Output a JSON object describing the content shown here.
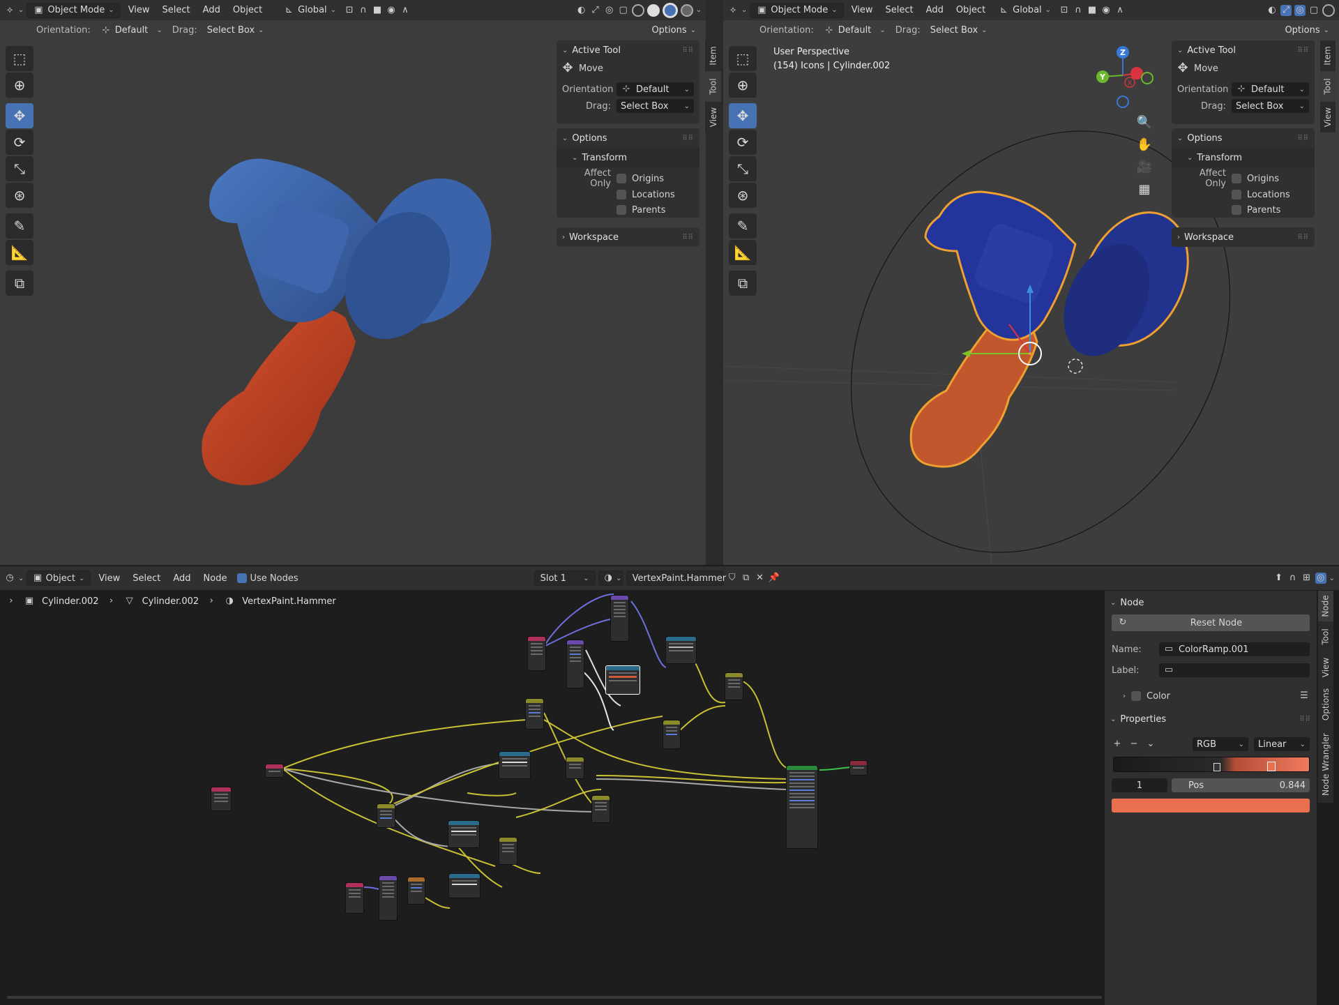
{
  "left_view": {
    "header": {
      "mode": "Object Mode",
      "menus": [
        "View",
        "Select",
        "Add",
        "Object"
      ],
      "orientation_global": "Global"
    },
    "subheader": {
      "orientation_label": "Orientation:",
      "orientation_value": "Default",
      "drag_label": "Drag:",
      "drag_value": "Select Box",
      "options": "Options"
    },
    "npanel": {
      "active_tool_title": "Active Tool",
      "tool_name": "Move",
      "orientation_label": "Orientation",
      "orientation_value": "Default",
      "drag_label": "Drag:",
      "drag_value": "Select Box",
      "options_title": "Options",
      "transform_title": "Transform",
      "affect_only": "Affect Only",
      "origins": "Origins",
      "locations": "Locations",
      "parents": "Parents",
      "workspace_title": "Workspace"
    },
    "tabs": [
      "Item",
      "Tool",
      "View"
    ]
  },
  "right_view": {
    "header": {
      "mode": "Object Mode",
      "menus": [
        "View",
        "Select",
        "Add",
        "Object"
      ],
      "orientation_global": "Global"
    },
    "subheader": {
      "orientation_label": "Orientation:",
      "orientation_value": "Default",
      "drag_label": "Drag:",
      "drag_value": "Select Box",
      "options": "Options"
    },
    "overlay": {
      "line1": "User Perspective",
      "line2": "(154) Icons | Cylinder.002"
    },
    "gizmo": {
      "z": "Z",
      "y": "Y",
      "x": "X"
    },
    "npanel": {
      "active_tool_title": "Active Tool",
      "tool_name": "Move",
      "orientation_label": "Orientation",
      "orientation_value": "Default",
      "drag_label": "Drag:",
      "drag_value": "Select Box",
      "options_title": "Options",
      "transform_title": "Transform",
      "affect_only": "Affect Only",
      "origins": "Origins",
      "locations": "Locations",
      "parents": "Parents",
      "workspace_title": "Workspace"
    },
    "tabs": [
      "Item",
      "Tool",
      "View"
    ]
  },
  "node_editor": {
    "header": {
      "mode": "Object",
      "menus": [
        "View",
        "Select",
        "Add",
        "Node"
      ],
      "use_nodes": "Use Nodes",
      "slot": "Slot 1",
      "material": "VertexPaint.Hammer"
    },
    "breadcrumb": [
      "Cylinder.002",
      "Cylinder.002",
      "VertexPaint.Hammer"
    ],
    "sidebar": {
      "node_title": "Node",
      "reset_node": "Reset Node",
      "name_label": "Name:",
      "name_value": "ColorRamp.001",
      "label_label": "Label:",
      "label_value": "",
      "color_title": "Color",
      "properties_title": "Properties",
      "color_mode": "RGB",
      "interpolation": "Linear",
      "stop_index": "1",
      "pos_label": "Pos",
      "pos_value": "0.844",
      "stop_color": "#e8704f"
    },
    "tabs": [
      "Node",
      "Tool",
      "View",
      "Options",
      "Node Wrangler"
    ]
  },
  "colors": {
    "accent": "#4772b3",
    "hammer_blue": "#3c63a8",
    "hammer_red": "#c84a2a",
    "selection_orange": "#f0a030"
  }
}
